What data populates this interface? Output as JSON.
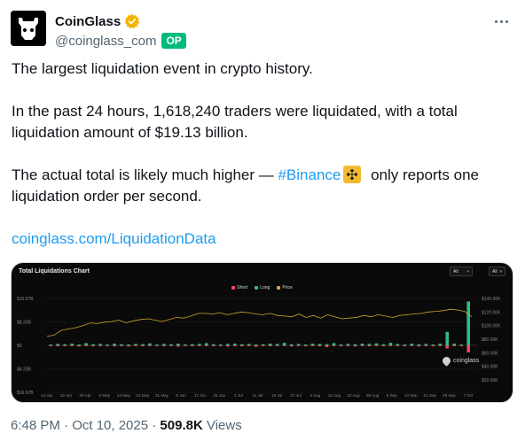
{
  "author": {
    "display_name": "CoinGlass",
    "handle": "@coinglass_com",
    "badge": "OP",
    "verified_color": "#f4b400"
  },
  "tweet": {
    "line1": "The largest liquidation event in crypto history.",
    "para2": "In the past 24 hours, 1,618,240 traders were liquidated, with a total liquidation amount of $19.13 billion.",
    "para3_prefix": "The actual total is likely much higher — ",
    "hashtag": "#Binance",
    "para3_suffix": " only reports one liquidation order per second.",
    "link": "coinglass.com/LiquidationData"
  },
  "media": {
    "chart_title": "Total Liquidations Chart",
    "select1": "All",
    "select2": "All",
    "watermark": "coinglass"
  },
  "chart_data": {
    "type": "bar",
    "title": "Total Liquidations Chart",
    "legend": [
      {
        "name": "Short",
        "color": "#f6465d"
      },
      {
        "name": "Long",
        "color": "#2ebd85"
      },
      {
        "name": "Price",
        "color": "#d4a72c"
      }
    ],
    "left_axis_ticks": [
      "$16.67B",
      "$8.33B",
      "$0",
      "$8.33B",
      "$16.67B"
    ],
    "right_axis_ticks": [
      "$140.00K",
      "$120.00K",
      "$100.00K",
      "$80.00K",
      "$60.00K",
      "$40.00K",
      "$20.00K"
    ],
    "x_ticks": [
      "14 Apr",
      "22 Apr",
      "30 Apr",
      "8 May",
      "14 May",
      "22 May",
      "31 May",
      "9 Jun",
      "17 Jun",
      "25 Jun",
      "3 Jul",
      "11 Jul",
      "19 Jul",
      "27 Jul",
      "4 Aug",
      "12 Aug",
      "20 Aug",
      "28 Aug",
      "5 Sep",
      "13 Sep",
      "21 Sep",
      "29 Sep",
      "7 Oct"
    ],
    "price_series": [
      84000,
      86000,
      93000,
      95000,
      97000,
      100000,
      104000,
      103000,
      105000,
      106000,
      108000,
      104000,
      107000,
      109000,
      110000,
      108000,
      106000,
      109000,
      112000,
      111000,
      114000,
      118000,
      118000,
      117000,
      119000,
      116000,
      118000,
      120000,
      119000,
      117000,
      116000,
      118000,
      115000,
      114000,
      113000,
      117000,
      112000,
      115000,
      111000,
      116000,
      113000,
      110000,
      111000,
      112000,
      115000,
      113000,
      116000,
      114000,
      112000,
      115000,
      116000,
      117000,
      118000,
      120000,
      121000,
      122000,
      124000,
      123000,
      121000,
      113000
    ],
    "long_liquidations_b": [
      0.3,
      0.5,
      0.4,
      0.6,
      0.3,
      0.8,
      0.4,
      0.5,
      0.3,
      0.6,
      0.4,
      0.3,
      0.5,
      0.4,
      0.7,
      0.3,
      0.5,
      0.4,
      0.6,
      0.3,
      0.4,
      0.5,
      0.8,
      0.4,
      0.3,
      0.5,
      0.6,
      0.4,
      0.5,
      0.3,
      0.4,
      0.6,
      0.5,
      0.9,
      0.4,
      0.5,
      0.3,
      0.6,
      0.5,
      0.4,
      0.8,
      0.3,
      0.5,
      0.4,
      0.6,
      0.5,
      0.7,
      0.4,
      0.9,
      0.5,
      0.3,
      0.6,
      0.4,
      0.5,
      0.3,
      0.6,
      4.8,
      0.6,
      0.3,
      15.6
    ],
    "short_liquidations_b": [
      0.2,
      0.3,
      0.2,
      0.1,
      0.4,
      0.2,
      0.3,
      0.1,
      0.2,
      0.3,
      0.2,
      0.4,
      0.2,
      0.3,
      0.2,
      0.1,
      0.3,
      0.2,
      0.4,
      0.2,
      0.3,
      0.2,
      0.1,
      0.3,
      0.2,
      0.4,
      0.2,
      0.3,
      0.2,
      0.5,
      0.2,
      0.3,
      0.2,
      0.1,
      0.4,
      0.2,
      0.3,
      0.2,
      0.3,
      0.6,
      0.2,
      0.3,
      0.2,
      0.4,
      0.2,
      0.3,
      0.2,
      0.3,
      0.2,
      0.1,
      0.3,
      0.2,
      0.4,
      0.2,
      0.3,
      0.2,
      1.1,
      0.3,
      0.2,
      2.5
    ]
  },
  "footer": {
    "time": "6:48 PM · Oct 10, 2025 · ",
    "views_num": "509.8K",
    "views_label": " Views"
  }
}
